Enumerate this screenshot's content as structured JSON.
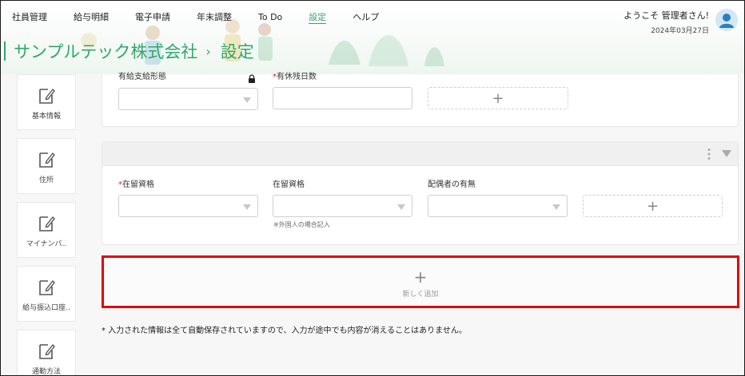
{
  "nav": {
    "items": [
      "社員管理",
      "給与明細",
      "電子申請",
      "年末調整",
      "To Do",
      "設定",
      "ヘルプ"
    ],
    "active_index": 5
  },
  "user": {
    "welcome": "ようこそ 管理者さん!",
    "date": "2024年03月27日"
  },
  "title": {
    "company": "サンプルテック株式会社",
    "separator": "›",
    "page": "設定"
  },
  "sidebar": {
    "items": [
      {
        "label": "基本情報",
        "icon": "edit-icon"
      },
      {
        "label": "住所",
        "icon": "edit-icon"
      },
      {
        "label": "マイナンバ..",
        "icon": "edit-icon"
      },
      {
        "label": "給与振込口座..",
        "icon": "edit-icon"
      },
      {
        "label": "通勤方法",
        "icon": "edit-icon"
      }
    ]
  },
  "section1": {
    "field1_label": "有給支給形態",
    "field2_required_mark": "*",
    "field2_label": "有休残日数",
    "add_label": "+"
  },
  "section2": {
    "field1_required_mark": "*",
    "field1_label": "在留資格",
    "field2_label": "在留資格",
    "field2_hint": "※外国人の場合記入",
    "field3_label": "配偶者の有無",
    "add_label": "+"
  },
  "new_add": {
    "plus": "+",
    "label": "新しく追加"
  },
  "footnote": "* 入力された情報は全て自動保存されていますので、入力が途中でも内容が消えることはありません。",
  "colors": {
    "accent": "#2fa86b",
    "required": "#d9232d",
    "highlight": "#e3000f"
  }
}
